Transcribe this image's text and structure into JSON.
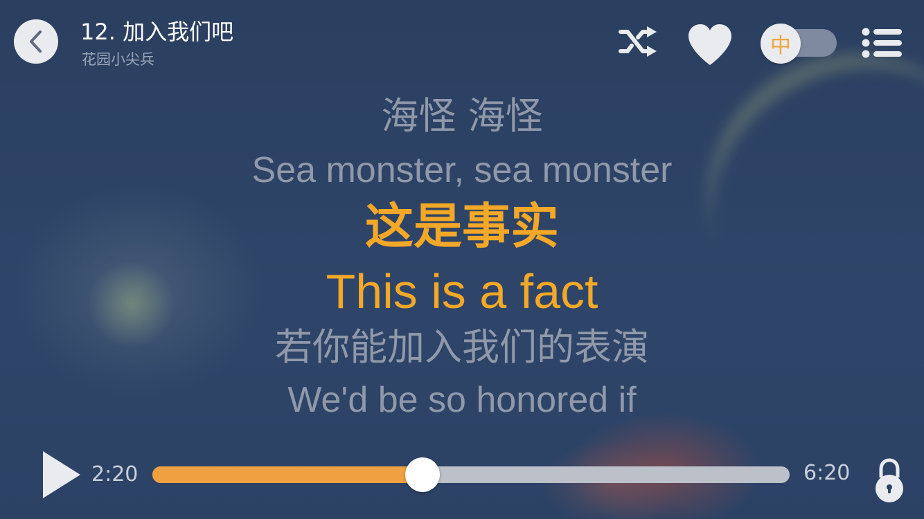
{
  "header": {
    "title": "12. 加入我们吧",
    "artist": "花园小尖兵",
    "back_icon": "back-chevron-icon",
    "shuffle_icon": "shuffle-icon",
    "favorite_icon": "heart-icon",
    "language_toggle_label": "中",
    "language_toggle_on": false,
    "menu_icon": "list-menu-icon"
  },
  "lyrics": [
    {
      "text": "海怪  海怪",
      "state": "past"
    },
    {
      "text": "Sea monster, sea monster",
      "state": "past"
    },
    {
      "text": "这是事实",
      "state": "current"
    },
    {
      "text": "This is a fact",
      "state": "current"
    },
    {
      "text": "若你能加入我们的表演",
      "state": "upcoming"
    },
    {
      "text": "We'd be so honored if",
      "state": "upcoming"
    }
  ],
  "player": {
    "play_icon": "play-icon",
    "elapsed": "2:20",
    "duration": "6:20",
    "progress_fraction": 0.4239,
    "lock_icon": "lock-icon"
  },
  "colors": {
    "accent": "#f3a827",
    "dim_text": "#8f99aa",
    "background": "#2c4264"
  }
}
